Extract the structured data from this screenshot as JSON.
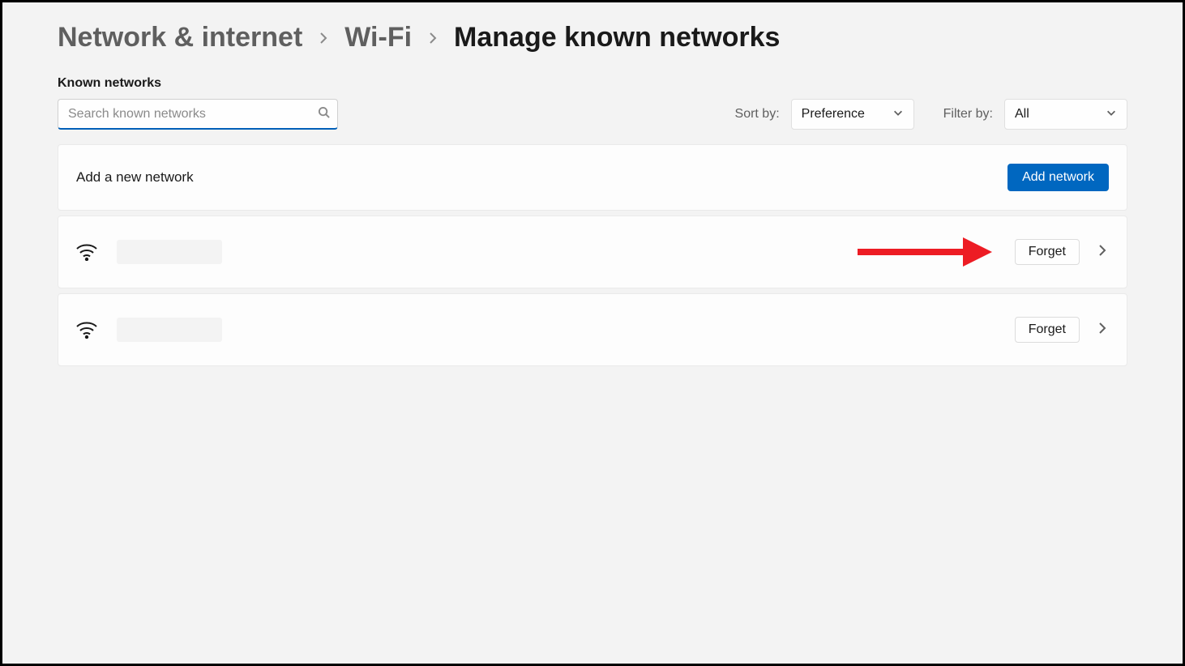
{
  "breadcrumb": {
    "level1": "Network & internet",
    "level2": "Wi-Fi",
    "level3": "Manage known networks"
  },
  "section_label": "Known networks",
  "search": {
    "placeholder": "Search known networks",
    "value": ""
  },
  "sort": {
    "label": "Sort by:",
    "selected": "Preference"
  },
  "filter": {
    "label": "Filter by:",
    "selected": "All"
  },
  "add_network": {
    "text": "Add a new network",
    "button": "Add network"
  },
  "networks": [
    {
      "forget_label": "Forget"
    },
    {
      "forget_label": "Forget"
    }
  ]
}
